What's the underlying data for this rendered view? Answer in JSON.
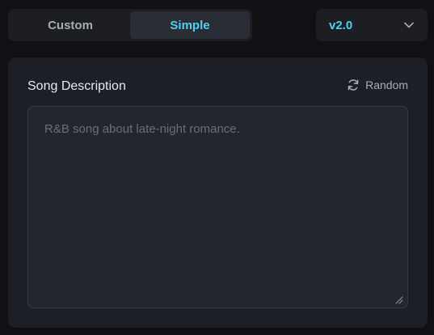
{
  "mode_toggle": {
    "tabs": [
      {
        "label": "Custom",
        "active": false
      },
      {
        "label": "Simple",
        "active": true
      }
    ]
  },
  "version_select": {
    "value": "v2.0",
    "icon": "chevron-down-icon"
  },
  "song_description": {
    "label": "Song Description",
    "random_label": "Random",
    "random_icon": "refresh-icon",
    "placeholder": "R&B song about late-night romance.",
    "value": ""
  },
  "colors": {
    "accent": "#4fd1f0",
    "background": "#111115",
    "panel": "#1c1f26",
    "input": "#23262e"
  }
}
